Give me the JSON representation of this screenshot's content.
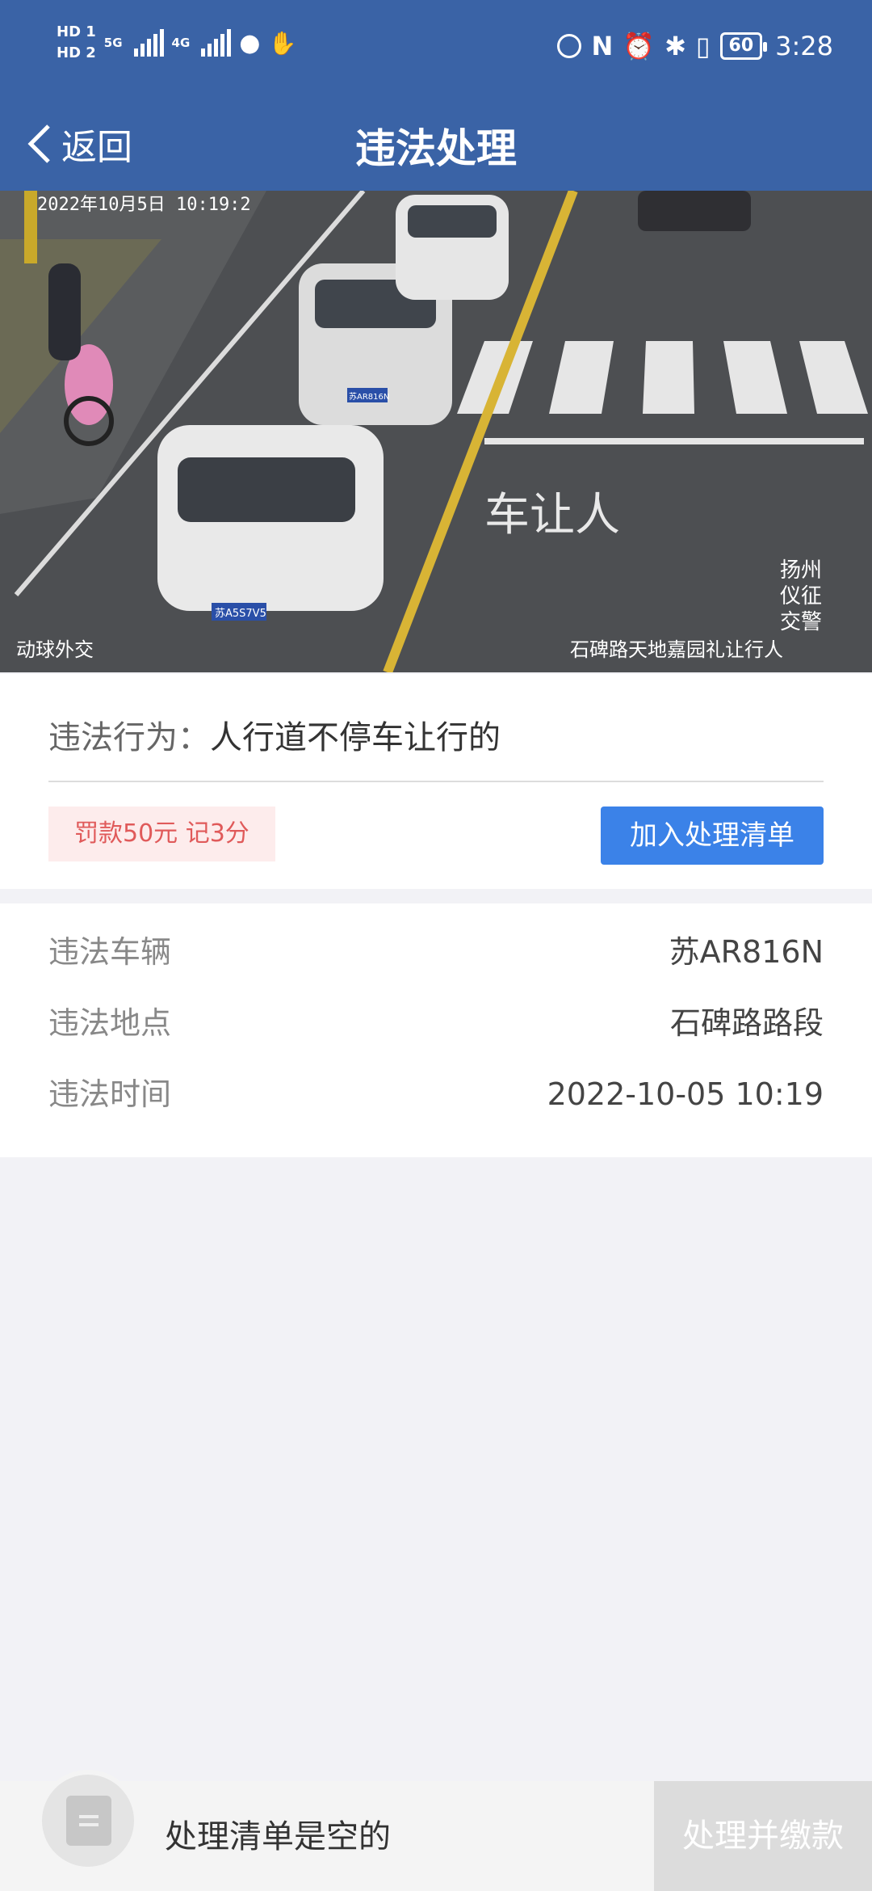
{
  "status_bar": {
    "hd1": "HD 1",
    "hd2": "HD 2",
    "net1": "5G",
    "net2": "4G",
    "battery": "60",
    "time": "3:28",
    "icons": [
      "wechat-icon",
      "hand-icon",
      "nfc-icon",
      "alarm-icon",
      "bluetooth-icon",
      "vibrate-icon"
    ]
  },
  "nav": {
    "back_label": "返回",
    "title": "违法处理"
  },
  "photo": {
    "timestamp": "2022年10月5日  10:19:2",
    "caption_left": "动球外交",
    "caption_right": "石碑路天地嘉园礼让行人",
    "road_text": "车让人",
    "watermark": [
      "扬州",
      "仪征",
      "交警"
    ],
    "plates": [
      "苏A5S7V5",
      "苏AR816N"
    ]
  },
  "violation": {
    "behavior_label": "违法行为：",
    "behavior_value": "人行道不停车让行的",
    "fine_tag": "罚款50元 记3分",
    "add_button": "加入处理清单"
  },
  "details": [
    {
      "key": "违法车辆",
      "value": "苏AR816N"
    },
    {
      "key": "违法地点",
      "value": "石碑路路段"
    },
    {
      "key": "违法时间",
      "value": "2022-10-05 10:19"
    }
  ],
  "bottom": {
    "empty_text": "处理清单是空的",
    "pay_button": "处理并缴款"
  },
  "colors": {
    "header": "#3a63a6",
    "primary_button": "#3b82e8",
    "fine_text": "#e05a5a",
    "fine_bg": "#fdecec"
  }
}
